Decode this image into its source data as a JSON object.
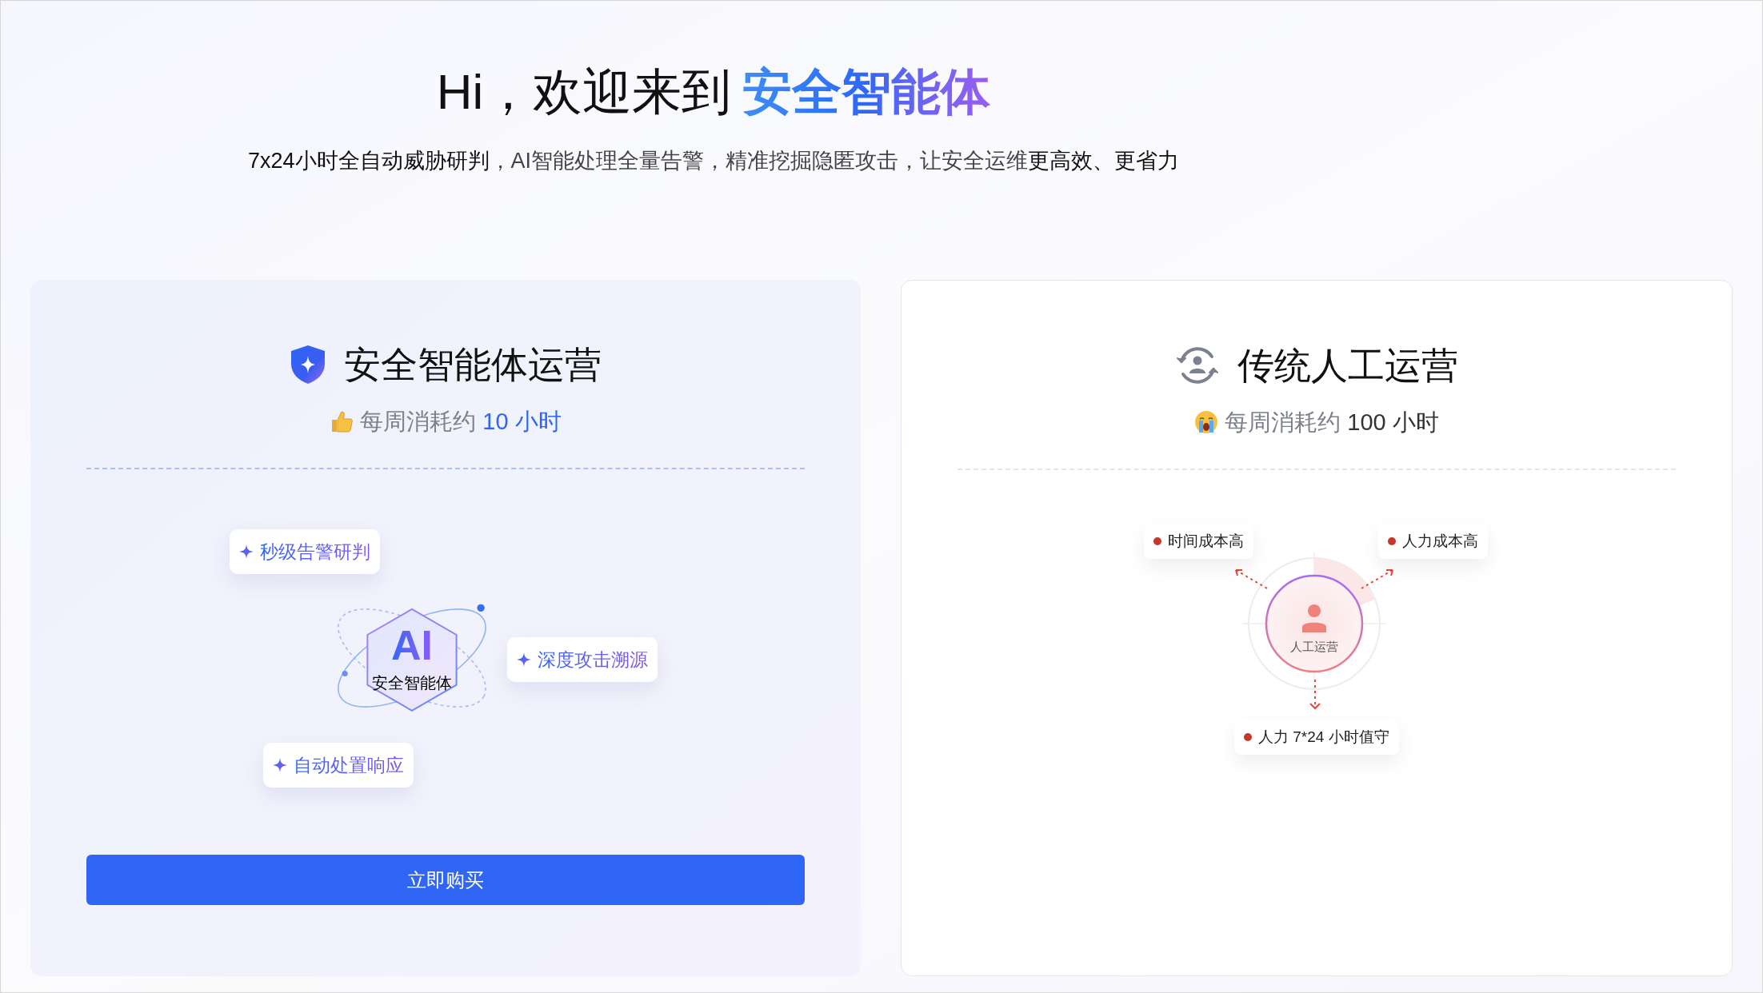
{
  "header": {
    "title": "Hi，欢迎来到",
    "title_highlight": "安全智能体",
    "subtitle": "**7x24小时全自动威胁研判**，AI智能处理全量告警，精准挖掘隐匿攻击，让安全运维**更高效、更省力**"
  },
  "cards": [
    {
      "kind": "agent",
      "title": "安全智能体运营",
      "usage_label": "每周消耗约",
      "usage_value": "10 小时",
      "center_label": "AI",
      "center_caption": "安全智能体",
      "points": [
        "秒级告警研判",
        "深度攻击溯源",
        "自动处置响应"
      ],
      "button": "立即购买"
    },
    {
      "kind": "manual",
      "title": "传统人工运营",
      "usage_label": "每周消耗约",
      "usage_value": "100 小时",
      "center_caption": "人工运营",
      "points": [
        "时间成本高",
        "人力成本高",
        "人力 7*24 小时值守"
      ]
    }
  ]
}
